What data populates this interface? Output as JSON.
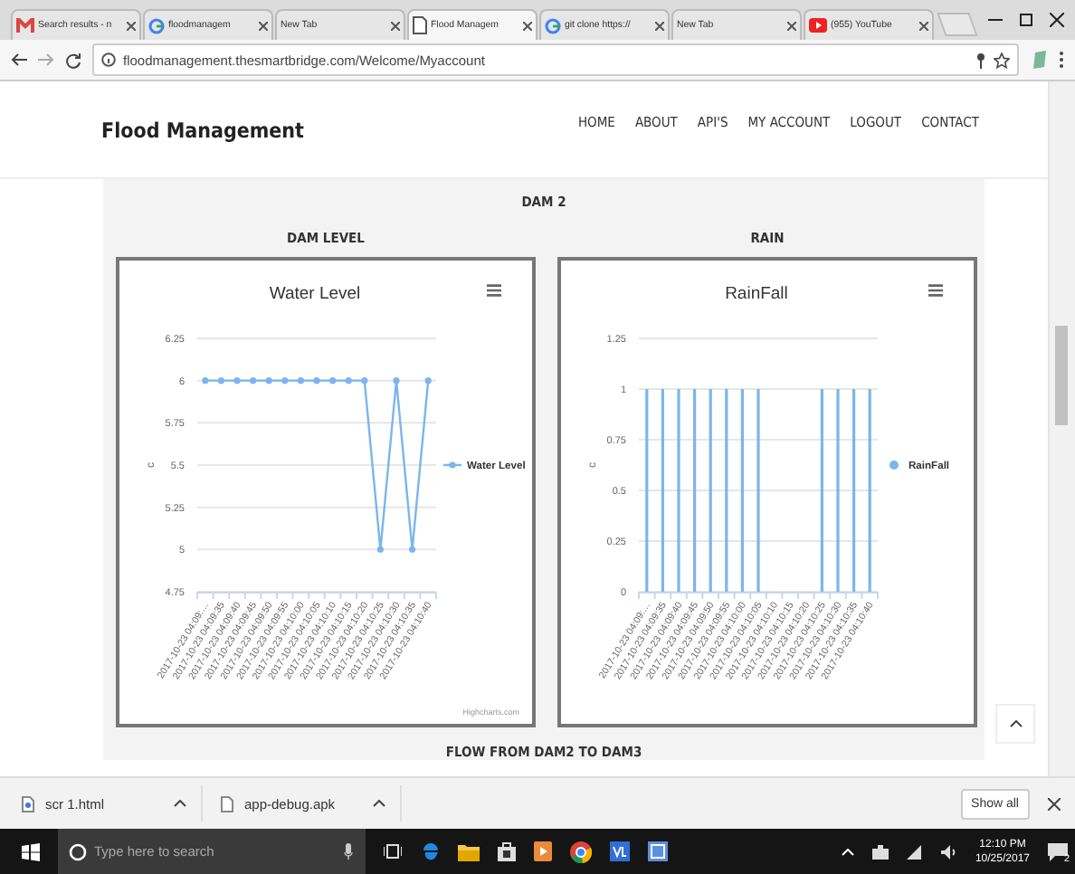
{
  "browser": {
    "tabs": [
      {
        "label": "Search results - n",
        "kind": "mail",
        "selected": false
      },
      {
        "label": "floodmanagem",
        "kind": "google",
        "selected": false
      },
      {
        "label": "New Tab",
        "kind": "blank",
        "selected": false
      },
      {
        "label": "Flood Managem",
        "kind": "page",
        "selected": true
      },
      {
        "label": "git clone https://",
        "kind": "google",
        "selected": false
      },
      {
        "label": "New Tab",
        "kind": "blank",
        "selected": false
      },
      {
        "label": "(955) YouTube",
        "kind": "video",
        "selected": false
      }
    ],
    "url": "floodmanagement.thesmartbridge.com/Welcome/Myaccount"
  },
  "site": {
    "title": "Flood Management",
    "nav": [
      "HOME",
      "ABOUT",
      "API'S",
      "MY ACCOUNT",
      "LOGOUT",
      "CONTACT"
    ]
  },
  "section": {
    "title": "DAM 2",
    "panels": [
      {
        "heading": "DAM LEVEL",
        "credit": "Highcharts.com",
        "chart_data": {
          "type": "line",
          "title": "Water Level",
          "ylabel": "c",
          "categories": [
            "2017-10-23 04:09:…",
            "2017-10-23 04:09:35",
            "2017-10-23 04:09:40",
            "2017-10-23 04:09:45",
            "2017-10-23 04:09:50",
            "2017-10-23 04:09:55",
            "2017-10-23 04:10:00",
            "2017-10-23 04:10:05",
            "2017-10-23 04:10:10",
            "2017-10-23 04:10:15",
            "2017-10-23 04:10:20",
            "2017-10-23 04:10:25",
            "2017-10-23 04:10:30",
            "2017-10-23 04:10:35",
            "2017-10-23 04:10:40"
          ],
          "series": [
            {
              "name": "Water Level",
              "color": "#7cb5ec",
              "marker": true,
              "values": [
                6,
                6,
                6,
                6,
                6,
                6,
                6,
                6,
                6,
                6,
                6,
                5,
                6,
                5,
                6
              ]
            }
          ],
          "grid": true,
          "ylim": [
            4.75,
            6.25
          ],
          "yticks": [
            4.75,
            5,
            5.25,
            5.5,
            5.75,
            6,
            6.25
          ]
        }
      },
      {
        "heading": "RAIN",
        "chart_data": {
          "type": "bar",
          "title": "RainFall",
          "ylabel": "c",
          "categories": [
            "2017-10-23 04:09:…",
            "2017-10-23 04:09:35",
            "2017-10-23 04:09:40",
            "2017-10-23 04:09:45",
            "2017-10-23 04:09:50",
            "2017-10-23 04:09:55",
            "2017-10-23 04:10:00",
            "2017-10-23 04:10:05",
            "2017-10-23 04:10:10",
            "2017-10-23 04:10:15",
            "2017-10-23 04:10:20",
            "2017-10-23 04:10:25",
            "2017-10-23 04:10:30",
            "2017-10-23 04:10:35",
            "2017-10-23 04:10:40"
          ],
          "series": [
            {
              "name": "RainFall",
              "color": "#7cb5ec",
              "values": [
                1,
                1,
                1,
                1,
                1,
                1,
                1,
                1,
                0,
                0,
                0,
                1,
                1,
                1,
                1
              ]
            }
          ],
          "grid": true,
          "ylim": [
            0,
            1.25
          ],
          "yticks": [
            0,
            0.25,
            0.5,
            0.75,
            1,
            1.25
          ]
        }
      }
    ],
    "next_title": "FLOW FROM DAM2 TO DAM3"
  },
  "downloads": {
    "items": [
      {
        "name": "scr 1.html",
        "kind": "html"
      },
      {
        "name": "app-debug.apk",
        "kind": "file"
      }
    ],
    "show_all": "Show all"
  },
  "taskbar": {
    "search_placeholder": "Type here to search",
    "time": "12:10 PM",
    "date": "10/25/2017",
    "notifications": "2"
  }
}
